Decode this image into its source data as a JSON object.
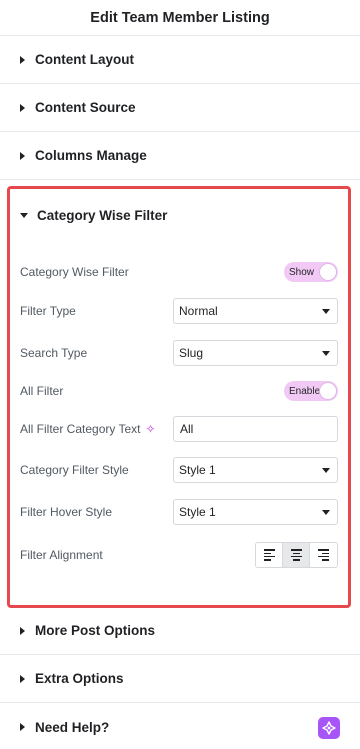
{
  "header": {
    "title": "Edit Team Member Listing"
  },
  "sections_top": [
    {
      "label": "Content Layout"
    },
    {
      "label": "Content Source"
    },
    {
      "label": "Columns Manage"
    }
  ],
  "open_section": {
    "label": "Category Wise Filter",
    "controls": {
      "category_wise_filter": {
        "label": "Category Wise Filter",
        "toggle_text": "Show"
      },
      "filter_type": {
        "label": "Filter Type",
        "value": "Normal"
      },
      "search_type": {
        "label": "Search Type",
        "value": "Slug"
      },
      "all_filter": {
        "label": "All Filter",
        "toggle_text": "Enable"
      },
      "all_filter_category_text": {
        "label": "All Filter Category Text",
        "value": "All"
      },
      "category_filter_style": {
        "label": "Category Filter Style",
        "value": "Style 1"
      },
      "filter_hover_style": {
        "label": "Filter Hover Style",
        "value": "Style 1"
      },
      "filter_alignment": {
        "label": "Filter Alignment",
        "options": [
          "left",
          "center",
          "right"
        ],
        "selected": "center"
      }
    }
  },
  "sections_bottom": [
    {
      "label": "More Post Options"
    },
    {
      "label": "Extra Options"
    },
    {
      "label": "Need Help?"
    }
  ],
  "colors": {
    "accent_pink": "#f2c9f4",
    "panel_border": "#e5484d",
    "help_purple": "#a855f7"
  }
}
